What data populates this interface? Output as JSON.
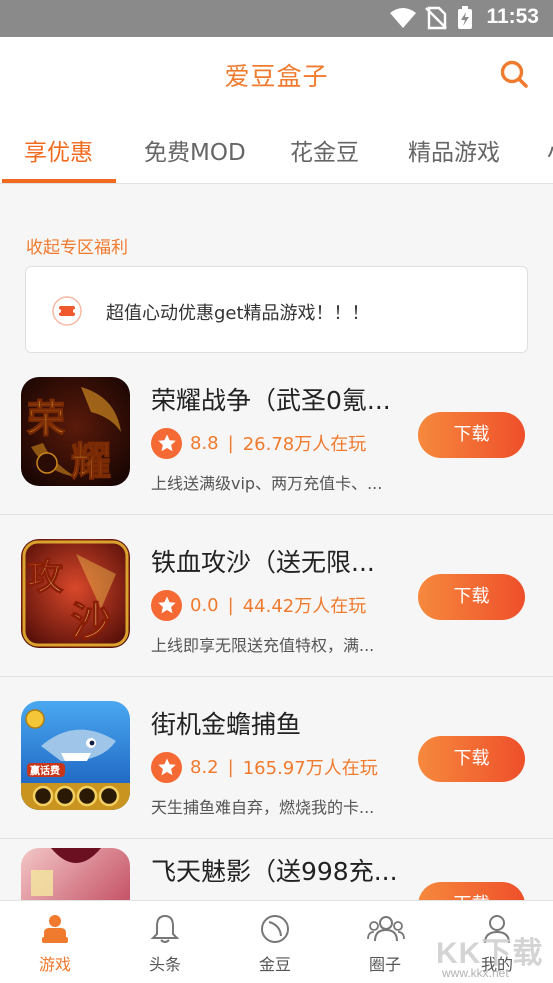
{
  "status_bar": {
    "time": "11:53",
    "icons": [
      "wifi-icon",
      "no-sim-icon",
      "battery-charging-icon"
    ]
  },
  "header": {
    "title": "爱豆盒子",
    "search_icon": "search-icon",
    "accent_color": "#f07a2d"
  },
  "tabs": [
    {
      "label": "享优惠",
      "active": true
    },
    {
      "label": "免费MOD",
      "active": false
    },
    {
      "label": "花金豆",
      "active": false
    },
    {
      "label": "精品游戏",
      "active": false
    },
    {
      "label": "小",
      "active": false
    }
  ],
  "section": {
    "label": "收起专区福利"
  },
  "notice": {
    "icon": "ticket-icon",
    "text": "超值心动优惠get精品游戏！！！"
  },
  "games": [
    {
      "title": "荣耀战争（武圣0氪...",
      "rating": "8.8",
      "players": "26.78万人在玩",
      "desc": "上线送满级vip、两万充值卡、...",
      "button": "下载",
      "icon_label": "荣耀"
    },
    {
      "title": "铁血攻沙（送无限...",
      "rating": "0.0",
      "players": "44.42万人在玩",
      "desc": "上线即享无限送充值特权，满...",
      "button": "下载",
      "icon_label": "攻沙"
    },
    {
      "title": "街机金蟾捕鱼",
      "rating": "8.2",
      "players": "165.97万人在玩",
      "desc": "天生捕鱼难自弃，燃烧我的卡...",
      "button": "下载",
      "icon_label": "赢话费"
    },
    {
      "title": "飞天魅影（送998充...",
      "rating": "",
      "players": "",
      "desc": "",
      "button": "下载",
      "icon_label": ""
    }
  ],
  "bottom_nav": [
    {
      "label": "游戏",
      "icon": "game-person-icon",
      "active": true
    },
    {
      "label": "头条",
      "icon": "bell-icon",
      "active": false
    },
    {
      "label": "金豆",
      "icon": "coin-icon",
      "active": false
    },
    {
      "label": "圈子",
      "icon": "group-icon",
      "active": false
    },
    {
      "label": "我的",
      "icon": "user-icon",
      "active": false
    }
  ],
  "watermark": {
    "big": "KK下载",
    "small": "www.kkx.net"
  }
}
